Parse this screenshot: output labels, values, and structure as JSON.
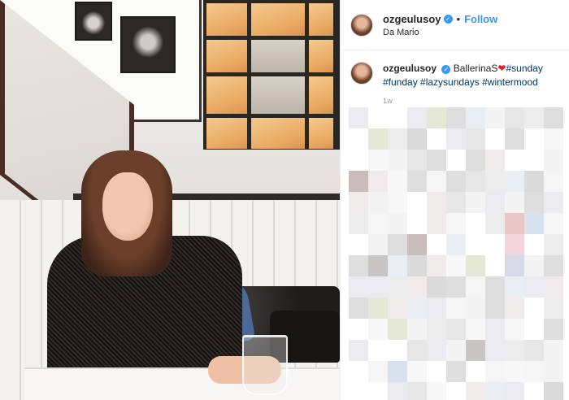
{
  "post": {
    "username": "ozgeulusoy",
    "location": "Da Mario",
    "follow_label": "Follow",
    "separator": "•",
    "verified_glyph": "✓"
  },
  "caption": {
    "username": "ozgeulusoy",
    "text_before_heart": "BallerinaS",
    "heart": "❤",
    "hashtags": [
      "#sunday",
      "#funday",
      "#lazysundays",
      "#wintermood"
    ],
    "time": "1w"
  },
  "colors": {
    "link_blue": "#3897f0",
    "hashtag_blue": "#003569",
    "verified_blue": "#3897f0",
    "heart_red": "#ed1c24"
  },
  "icons": {
    "verified": "verified-badge-icon",
    "heart": "red-heart-icon"
  }
}
